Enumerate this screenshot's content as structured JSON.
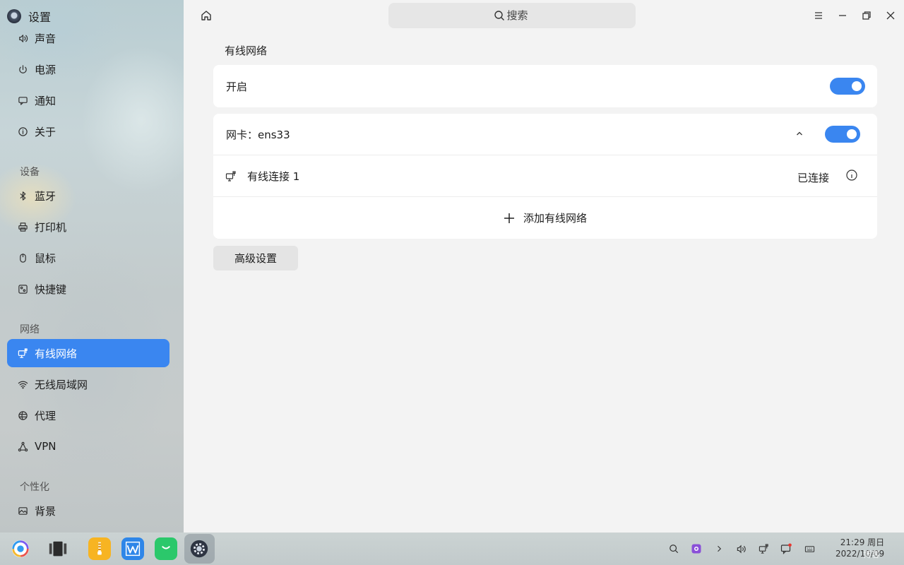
{
  "app": {
    "title": "设置"
  },
  "sidebar": {
    "items_top": [
      {
        "label": "声音",
        "icon": "speaker-icon"
      },
      {
        "label": "电源",
        "icon": "power-icon"
      },
      {
        "label": "通知",
        "icon": "notification-icon"
      },
      {
        "label": "关于",
        "icon": "info-icon"
      }
    ],
    "groups": [
      {
        "title": "设备",
        "items": [
          {
            "label": "蓝牙",
            "icon": "bluetooth-icon"
          },
          {
            "label": "打印机",
            "icon": "printer-icon"
          },
          {
            "label": "鼠标",
            "icon": "mouse-icon"
          },
          {
            "label": "快捷键",
            "icon": "shortcut-icon"
          }
        ]
      },
      {
        "title": "网络",
        "items": [
          {
            "label": "有线网络",
            "icon": "wired-network-icon",
            "active": true
          },
          {
            "label": "无线局域网",
            "icon": "wifi-icon"
          },
          {
            "label": "代理",
            "icon": "proxy-icon"
          },
          {
            "label": "VPN",
            "icon": "vpn-icon"
          }
        ]
      },
      {
        "title": "个性化",
        "items": [
          {
            "label": "背景",
            "icon": "background-icon"
          }
        ]
      }
    ]
  },
  "topbar": {
    "search_placeholder": "搜索"
  },
  "main": {
    "section_title": "有线网络",
    "enable_label": "开启",
    "enable_on": true,
    "adapter": {
      "label": "网卡：ens33",
      "on": true,
      "connection_name": "有线连接 1",
      "connection_status": "已连接",
      "add_label": "添加有线网络"
    },
    "advanced_button": "高级设置"
  },
  "taskbar": {
    "apps": [
      "launcher-icon",
      "multitask-view-icon",
      "archive-manager-icon",
      "wps-office-icon",
      "wechat-icon",
      "settings-icon"
    ],
    "tray": [
      "search-icon",
      "screen-recorder-icon",
      "expand-arrow-icon",
      "volume-icon",
      "network-icon",
      "notification-icon",
      "keyboard-icon"
    ],
    "clock_time": "21:29 周日",
    "clock_date": "2022/10/09",
    "watermark": "博客"
  },
  "colors": {
    "accent": "#3a86f0",
    "card": "#ffffff",
    "background": "#f3f3f3"
  }
}
